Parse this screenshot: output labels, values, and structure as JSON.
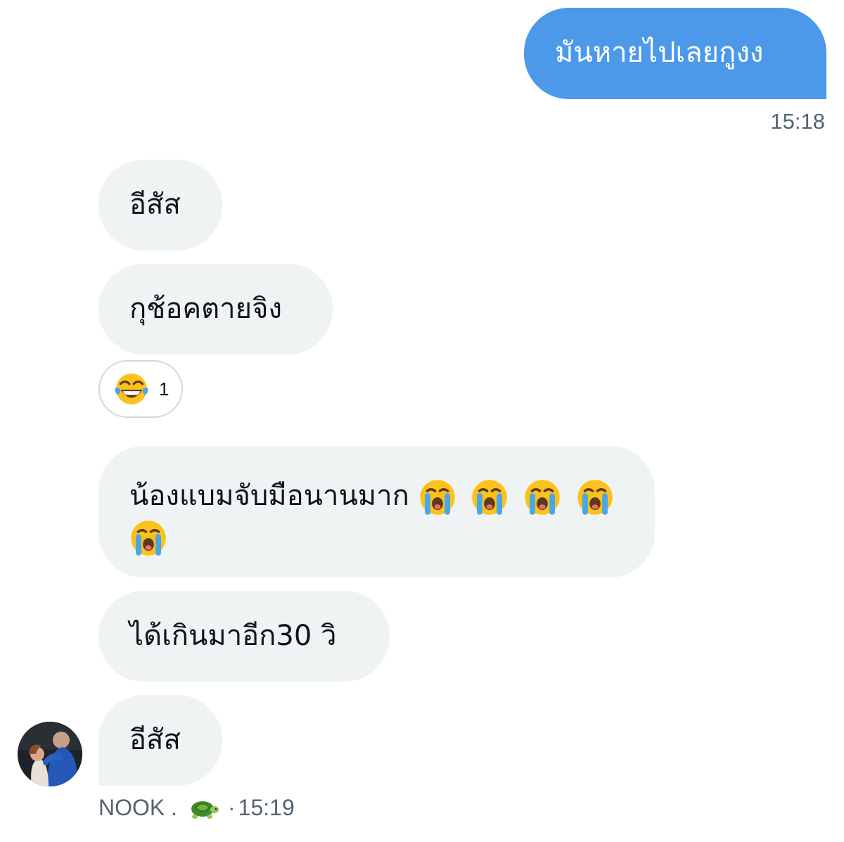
{
  "messages": {
    "m1": {
      "text": "มันหายไปเลยกูงง",
      "time": "15:18"
    },
    "m2": {
      "text": "อีสัส"
    },
    "m3": {
      "text": "กุช้อคตายจิง",
      "reaction": {
        "emoji": "face-with-tears-of-joy",
        "count": "1"
      }
    },
    "m4": {
      "text": "น้องแบมจับมือนานมาก"
    },
    "m5": {
      "text": "ได้เกินมาอีก30 วิ"
    },
    "m6": {
      "text": "อีสัส"
    }
  },
  "sender": {
    "name": "NOOK .",
    "emoji": "turtle-icon",
    "separator": "·",
    "time": "15:19"
  },
  "colors": {
    "outgoing_bubble": "#4c99e9",
    "incoming_bubble": "#eff3f4",
    "meta_text": "#536471"
  }
}
